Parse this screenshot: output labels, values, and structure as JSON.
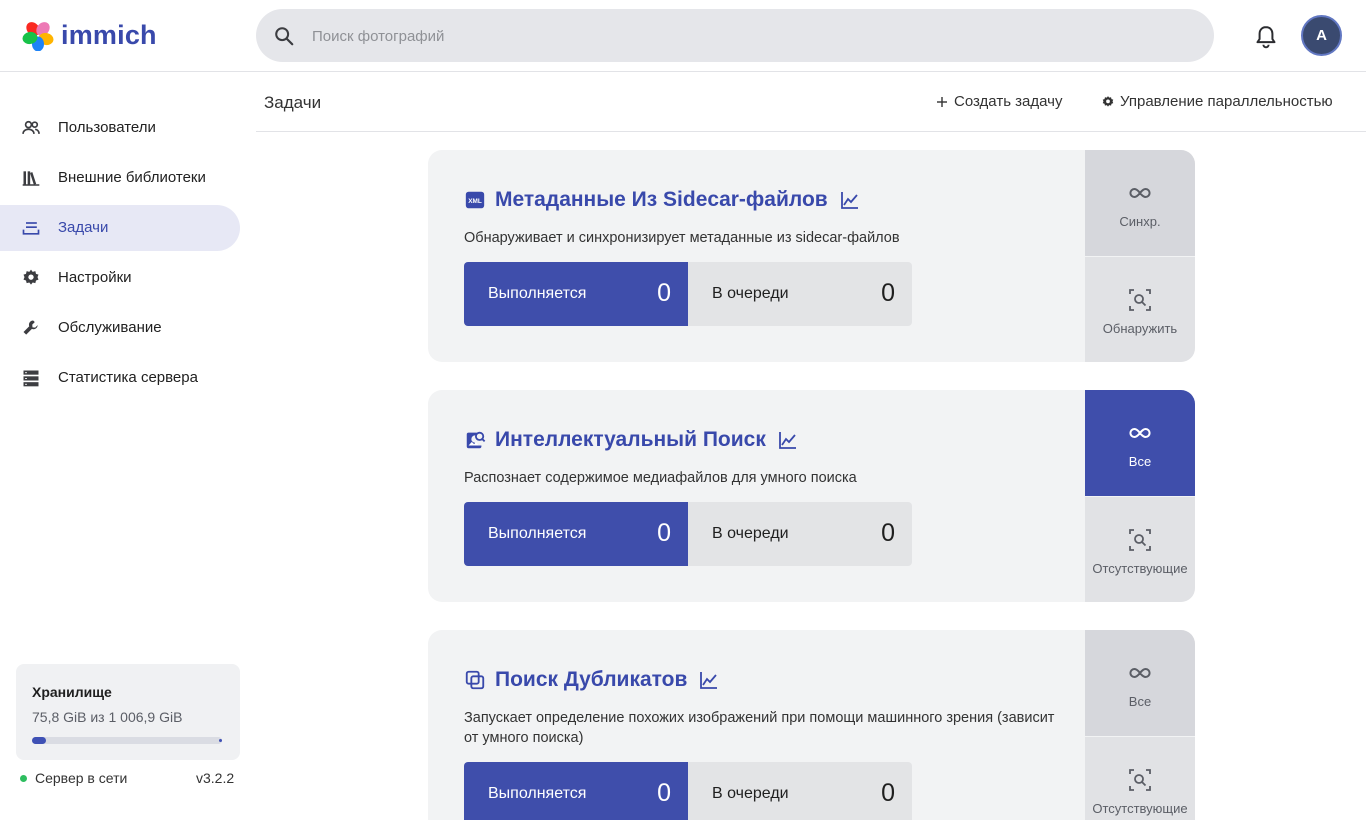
{
  "app": {
    "name": "immich"
  },
  "search": {
    "placeholder": "Поиск фотографий"
  },
  "user": {
    "avatar_initial": "A"
  },
  "sidebar": {
    "items": [
      {
        "label": "Пользователи",
        "icon": "users-icon",
        "active": false
      },
      {
        "label": "Внешние библиотеки",
        "icon": "library-icon",
        "active": false
      },
      {
        "label": "Задачи",
        "icon": "jobs-icon",
        "active": true
      },
      {
        "label": "Настройки",
        "icon": "gear-icon",
        "active": false
      },
      {
        "label": "Обслуживание",
        "icon": "wrench-icon",
        "active": false
      },
      {
        "label": "Статистика сервера",
        "icon": "server-icon",
        "active": false
      }
    ],
    "storage": {
      "title": "Хранилище",
      "used_text": "75,8 GiB из 1 006,9 GiB",
      "used_fraction": 0.075
    },
    "server": {
      "status": "Сервер в сети",
      "version": "v3.2.2",
      "status_color": "#2dbd5f"
    }
  },
  "header": {
    "title": "Задачи",
    "create_label": "Создать задачу",
    "concurrency_label": "Управление параллельностью"
  },
  "jobs": [
    {
      "title": "Метаданные Из Sidecar-файлов",
      "icon": "xml-file-icon",
      "description": "Обнаруживает и синхронизирует метаданные из sidecar-файлов",
      "active_label": "Выполняется",
      "active_count": "0",
      "queued_label": "В очереди",
      "queued_count": "0",
      "action_top": "Синхр.",
      "action_bottom": "Обнаружить"
    },
    {
      "title": "Интеллектуальный Поиск",
      "icon": "image-search-icon",
      "description": "Распознает содержимое медиафайлов для умного поиска",
      "active_label": "Выполняется",
      "active_count": "0",
      "queued_label": "В очереди",
      "queued_count": "0",
      "action_top": "Все",
      "action_bottom": "Отсутствующие"
    },
    {
      "title": "Поиск Дубликатов",
      "icon": "duplicate-icon",
      "description": "Запускает определение похожих изображений при помощи машинного зрения (зависит от умного поиска)",
      "active_label": "Выполняется",
      "active_count": "0",
      "queued_label": "В очереди",
      "queued_count": "0",
      "action_top": "Все",
      "action_bottom": "Отсутствующие"
    }
  ],
  "colors": {
    "accent": "#3f4eab",
    "brand": "#3949ab"
  }
}
